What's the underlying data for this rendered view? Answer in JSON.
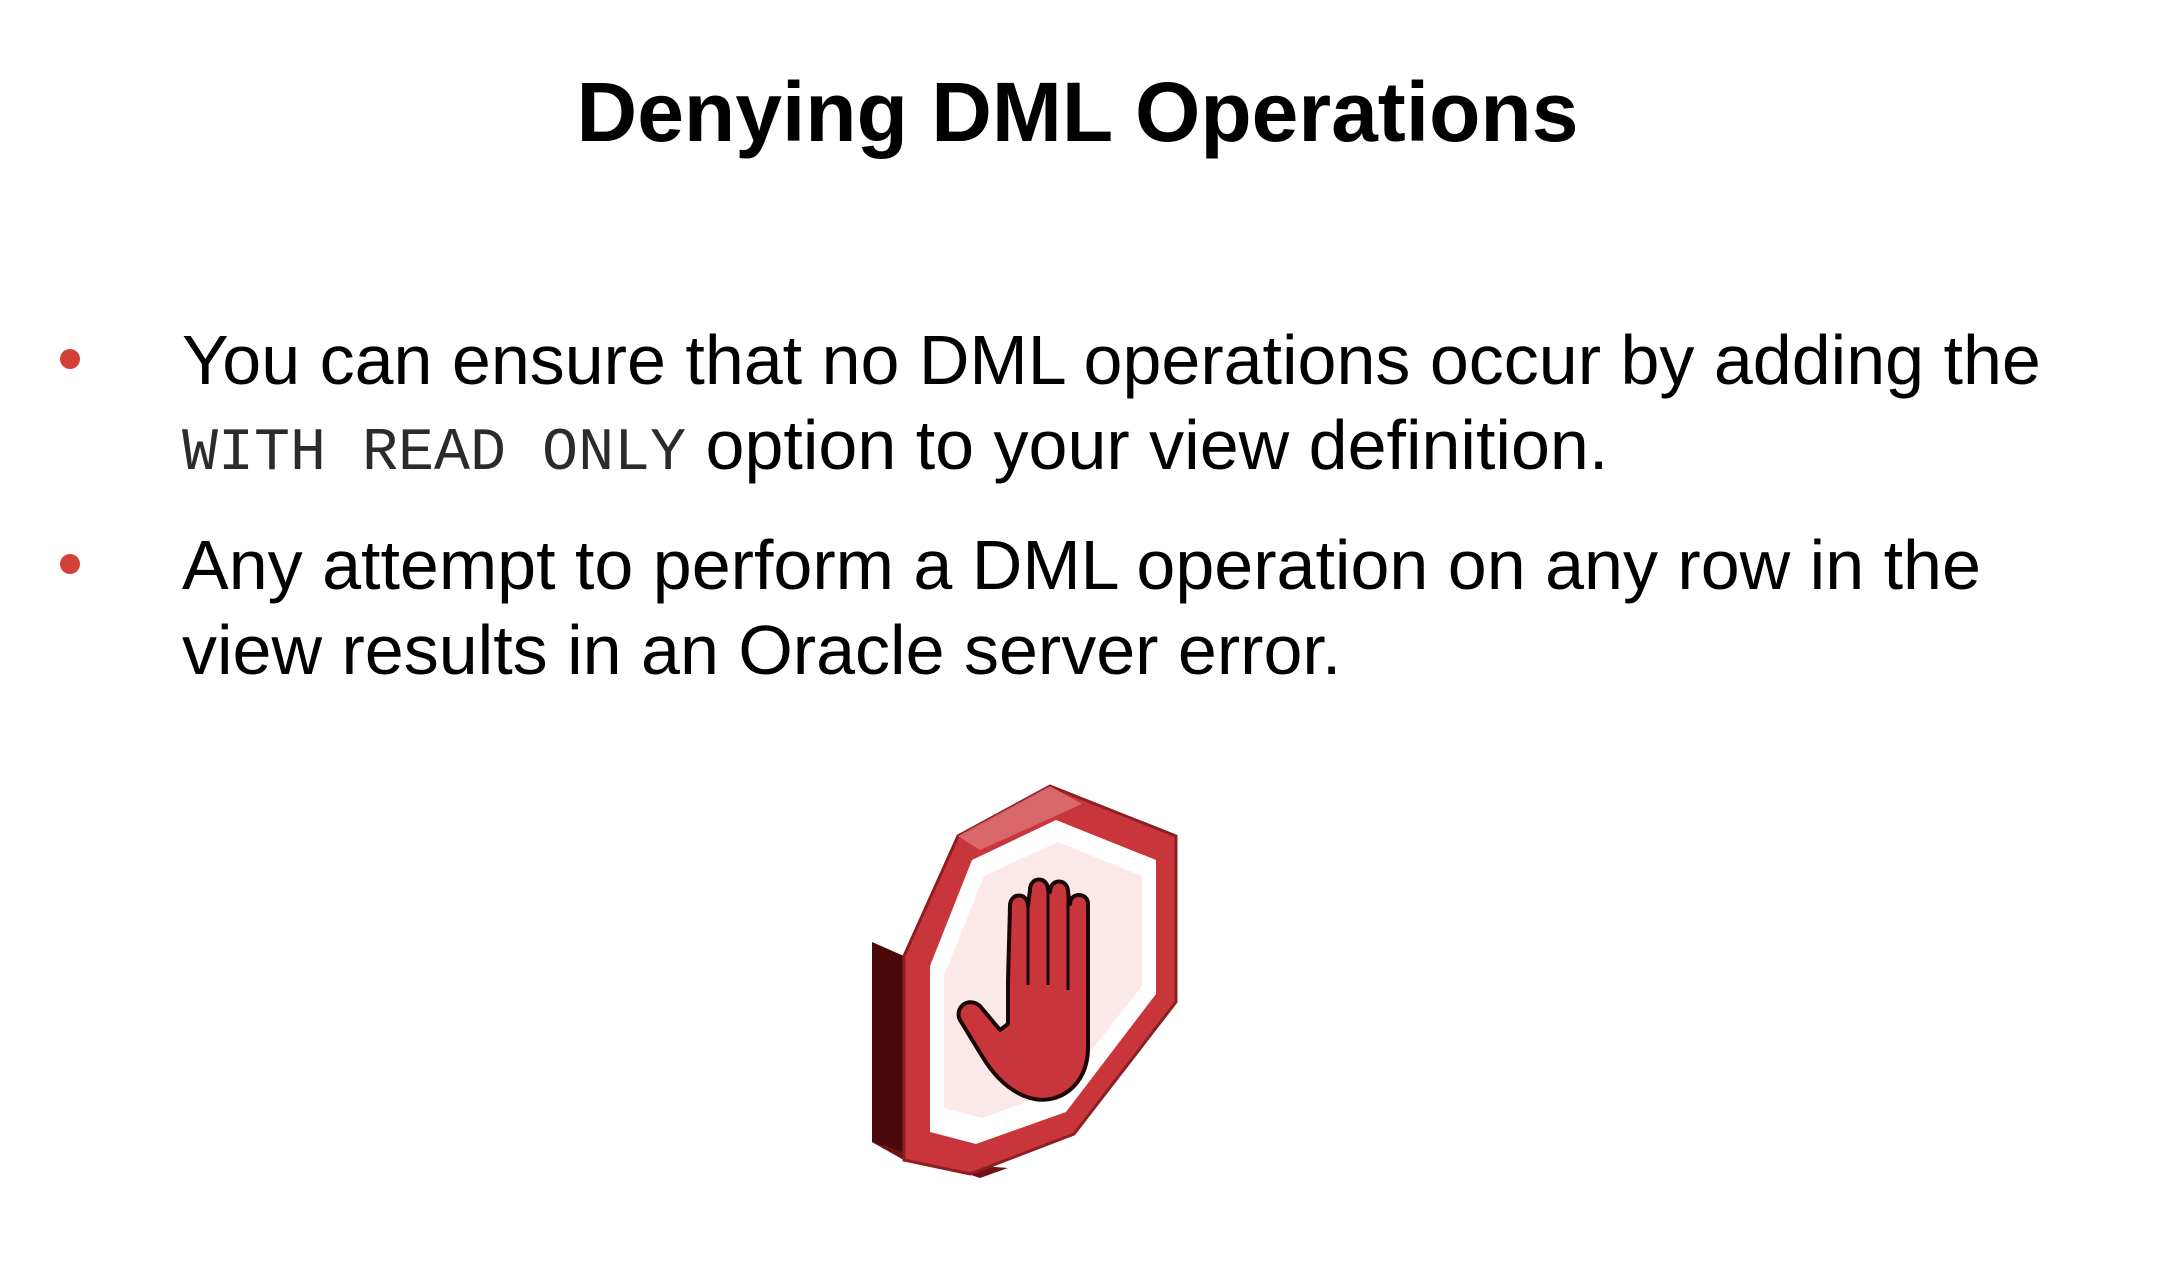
{
  "slide": {
    "title": "Denying DML Operations",
    "bullets": [
      {
        "before": "You can ensure that no DML operations occur by adding the ",
        "code": "WITH READ ONLY",
        "after": " option to your view definition."
      },
      {
        "before": "Any attempt to perform a DML operation on any row in the view results in an Oracle server error.",
        "code": "",
        "after": ""
      }
    ],
    "icon": "stop-hand-icon",
    "colors": {
      "bullet": "#d1413a",
      "sign_red": "#c8353a",
      "sign_dark": "#4a0a0c",
      "sign_inner": "#fbe8e8"
    }
  }
}
